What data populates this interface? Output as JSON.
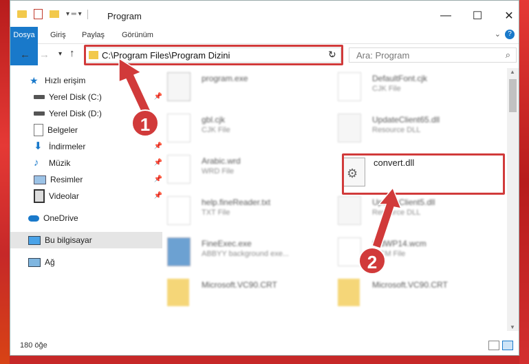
{
  "window": {
    "title": "Program"
  },
  "ribbon": {
    "tabs": [
      "Dosya",
      "Giriş",
      "Paylaş",
      "Görünüm"
    ]
  },
  "address": {
    "path": "C:\\Program Files\\Program Dizini"
  },
  "search": {
    "placeholder": "Ara: Program"
  },
  "sidebar": {
    "items": [
      {
        "label": "Hızlı erişim",
        "icon": "star-icon"
      },
      {
        "label": "Yerel Disk (C:)",
        "icon": "drive-icon"
      },
      {
        "label": "Yerel Disk (D:)",
        "icon": "drive-icon"
      },
      {
        "label": "Belgeler",
        "icon": "documents-icon"
      },
      {
        "label": "İndirmeler",
        "icon": "download-icon"
      },
      {
        "label": "Müzik",
        "icon": "music-icon"
      },
      {
        "label": "Resimler",
        "icon": "pictures-icon"
      },
      {
        "label": "Videolar",
        "icon": "videos-icon"
      },
      {
        "label": "OneDrive",
        "icon": "cloud-icon"
      },
      {
        "label": "Bu bilgisayar",
        "icon": "computer-icon"
      },
      {
        "label": "Ağ",
        "icon": "network-icon"
      }
    ]
  },
  "files": [
    {
      "name": "program.exe",
      "type": ""
    },
    {
      "name": "DefaultFont.cjk",
      "type": "CJK File"
    },
    {
      "name": "gbl.cjk",
      "type": "CJK File"
    },
    {
      "name": "UpdateClient65.dll",
      "type": "Resource DLL"
    },
    {
      "name": "Arabic.wrd",
      "type": "WRD File"
    },
    {
      "name": "convert.dll",
      "type": ""
    },
    {
      "name": "help.fineReader.txt",
      "type": "TXT File"
    },
    {
      "name": "UpdateClient5.dll",
      "type": "Resource DLL"
    },
    {
      "name": "FineExec.exe",
      "type": "ABBYY background exe..."
    },
    {
      "name": "StdWP14.wcm",
      "type": "WCM File"
    },
    {
      "name": "Microsoft.VC90.CRT",
      "type": ""
    },
    {
      "name": "Microsoft.VC90.CRT",
      "type": ""
    }
  ],
  "status": {
    "count": "180 öğe"
  },
  "annotations": {
    "badge1": "1",
    "badge2": "2"
  },
  "colors": {
    "accent": "#1979ca",
    "highlight": "#d13a3a"
  }
}
